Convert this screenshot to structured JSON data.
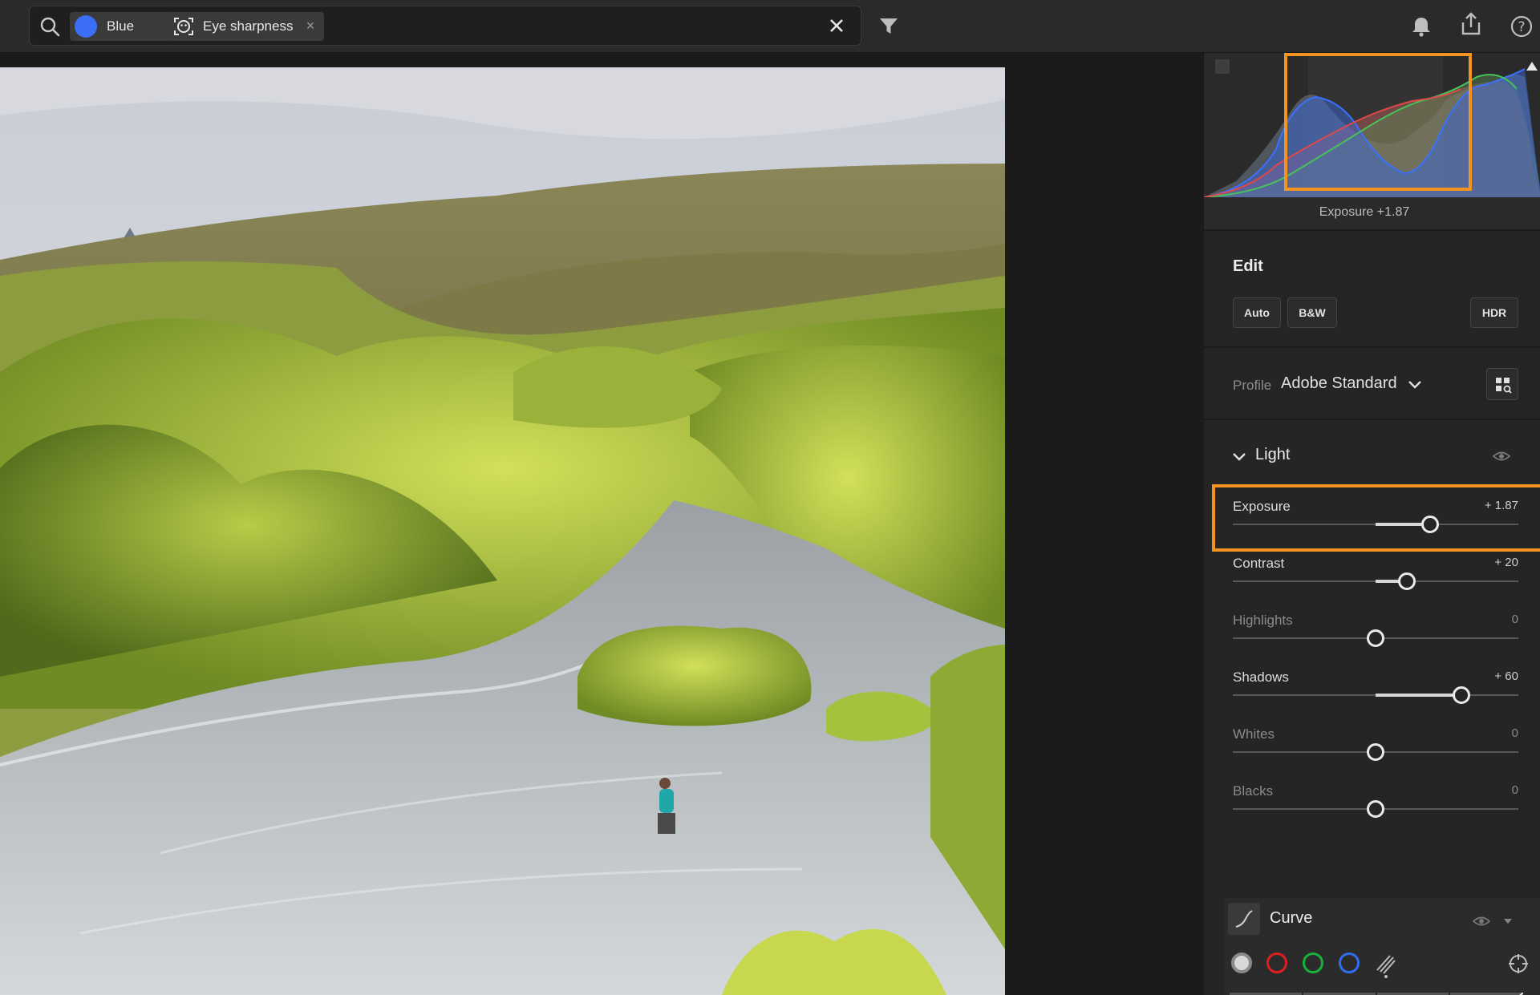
{
  "search": {
    "chips": [
      {
        "label": "Blue",
        "color": "#3b6ef5"
      },
      {
        "label": "Eye sharpness"
      }
    ]
  },
  "histogram": {
    "readout": "Exposure  +1.87",
    "highlight_color": "#f39420"
  },
  "edit": {
    "title": "Edit",
    "buttons": {
      "auto": "Auto",
      "bw": "B&W",
      "hdr": "HDR"
    },
    "profile_label": "Profile",
    "profile_value": "Adobe Standard"
  },
  "light": {
    "title": "Light",
    "sliders": [
      {
        "label": "Exposure",
        "value": "+ 1.87",
        "position": 0.69
      },
      {
        "label": "Contrast",
        "value": "+ 20",
        "position": 0.61
      },
      {
        "label": "Highlights",
        "value": "0",
        "position": 0.5
      },
      {
        "label": "Shadows",
        "value": "+ 60",
        "position": 0.8
      },
      {
        "label": "Whites",
        "value": "0",
        "position": 0.5
      },
      {
        "label": "Blacks",
        "value": "0",
        "position": 0.5
      }
    ]
  },
  "curve": {
    "title": "Curve",
    "channels": [
      "point",
      "red",
      "green",
      "blue",
      "parametric"
    ]
  }
}
